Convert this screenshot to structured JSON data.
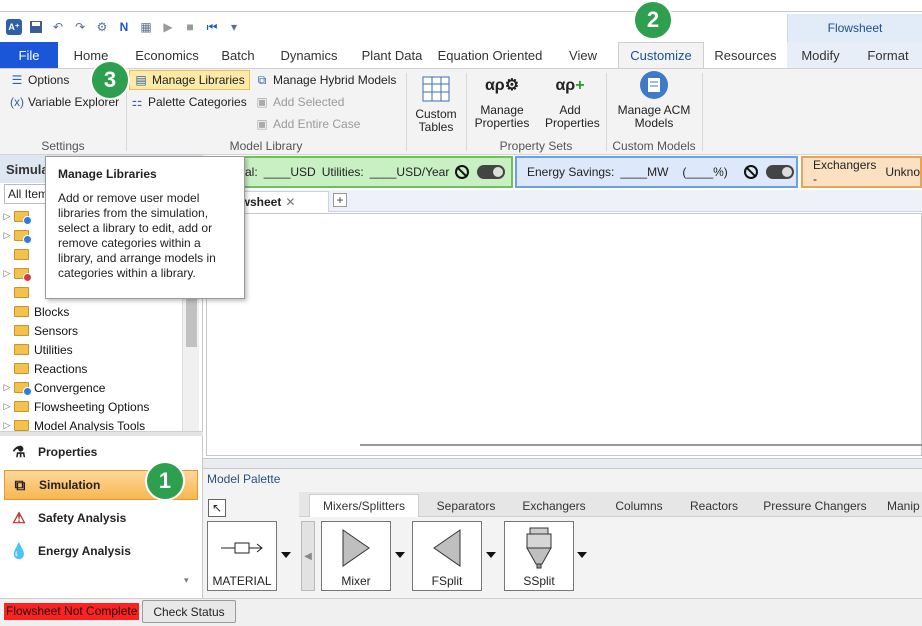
{
  "quick_access": {
    "icons": [
      "app-icon",
      "save-icon",
      "undo-icon",
      "redo-icon",
      "network-icon",
      "next-icon",
      "form-icon",
      "run-icon",
      "stop-icon",
      "reset-icon",
      "customize-qat-icon"
    ]
  },
  "context_tab_header": "Flowsheet",
  "tabs": [
    {
      "label": "File"
    },
    {
      "label": "Home"
    },
    {
      "label": "Economics"
    },
    {
      "label": "Batch"
    },
    {
      "label": "Dynamics"
    },
    {
      "label": "Plant Data"
    },
    {
      "label": "Equation Oriented"
    },
    {
      "label": "View"
    },
    {
      "label": "Customize"
    },
    {
      "label": "Resources"
    },
    {
      "label": "Modify"
    },
    {
      "label": "Format"
    }
  ],
  "ribbon": {
    "settings": {
      "options": "Options",
      "variable_explorer": "Variable Explorer",
      "group_label": "Settings"
    },
    "model_library": {
      "manage_libraries": "Manage Libraries",
      "palette_categories": "Palette Categories",
      "manage_hybrid_models": "Manage Hybrid Models",
      "add_selected": "Add Selected",
      "add_entire_case": "Add Entire Case",
      "group_label": "Model Library"
    },
    "custom_tables": "Custom Tables",
    "property_sets": {
      "manage_properties": "Manage Properties",
      "add_properties": "Add Properties",
      "group_label": "Property Sets"
    },
    "custom_models": {
      "manage_acm_models": "Manage ACM Models",
      "group_label": "Custom Models"
    }
  },
  "badges": {
    "one": "1",
    "two": "2",
    "three": "3"
  },
  "tooltip": {
    "title": "Manage Libraries",
    "body": "Add or remove user model libraries from the simulation, select a library to edit, add or remove categories within a library, and arrange models in categories within a library."
  },
  "left_pane": {
    "header": "Simula",
    "filter": "All Item",
    "tree": [
      {
        "label": "",
        "icon": "folder-check",
        "expand": true
      },
      {
        "label": "",
        "icon": "folder-check",
        "expand": true
      },
      {
        "label": "",
        "icon": "folder",
        "expand": false
      },
      {
        "label": "",
        "icon": "folder-error",
        "expand": true
      },
      {
        "label": "",
        "icon": "folder",
        "expand": false
      },
      {
        "label": "Blocks",
        "icon": "folder",
        "expand": false
      },
      {
        "label": "Sensors",
        "icon": "folder",
        "expand": false
      },
      {
        "label": "Utilities",
        "icon": "folder",
        "expand": false
      },
      {
        "label": "Reactions",
        "icon": "folder",
        "expand": false
      },
      {
        "label": "Convergence",
        "icon": "folder-check",
        "expand": true
      },
      {
        "label": "Flowsheeting Options",
        "icon": "folder",
        "expand": true
      },
      {
        "label": "Model Analysis Tools",
        "icon": "folder",
        "expand": true
      }
    ],
    "nav": [
      {
        "label": "Properties",
        "icon": "flask-icon"
      },
      {
        "label": "Simulation",
        "icon": "flowsheet-icon"
      },
      {
        "label": "Safety Analysis",
        "icon": "safety-icon"
      },
      {
        "label": "Energy Analysis",
        "icon": "energy-icon"
      }
    ]
  },
  "indicators": {
    "cost_prefix": "al:",
    "cost_value": "____USD",
    "utilities_label": "Utilities:",
    "utilities_value": "____USD/Year",
    "energy_savings_label": "Energy Savings:",
    "energy_savings_value": "____MW",
    "energy_savings_pct": "(____%)",
    "exchangers_label": "Exchangers -",
    "exchangers_value": "Unkno"
  },
  "document": {
    "tab_label": "n Flowsheet",
    "close": "✕",
    "add": "+"
  },
  "palette": {
    "title": "Model Palette",
    "tabs": [
      "Mixers/Splitters",
      "Separators",
      "Exchangers",
      "Columns",
      "Reactors",
      "Pressure Changers",
      "Manip"
    ],
    "items": [
      "MATERIAL",
      "Mixer",
      "FSplit",
      "SSplit"
    ]
  },
  "status": {
    "message": "Flowsheet Not Complete",
    "check_button": "Check Status"
  },
  "colors": {
    "file_tab": "#1a57d8",
    "badge": "#2e9e4f",
    "status_error": "#ff2020",
    "active_nav": "#f7b750"
  }
}
